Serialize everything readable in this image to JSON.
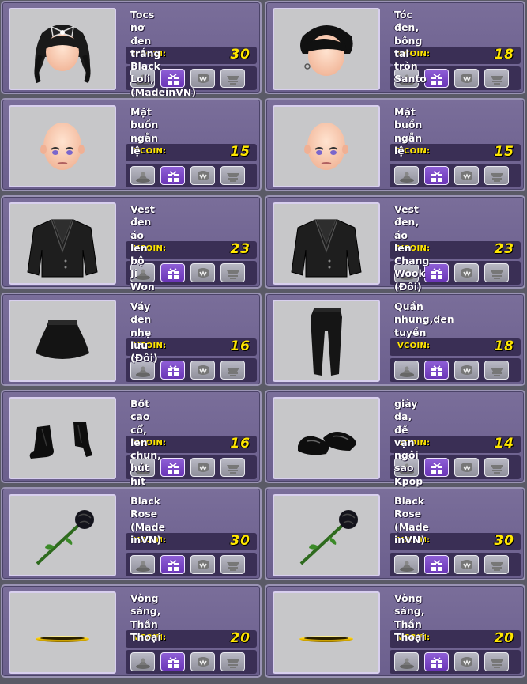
{
  "currency_label": "VCOIN:",
  "items": [
    {
      "name": "Tocs nơ đen trắng Black Loli,(MadeinVN)",
      "price": "30",
      "icon": "hair-bow-icon"
    },
    {
      "name": "Tóc đen, bông tai tròn Santo",
      "price": "18",
      "icon": "hair-earring-icon"
    },
    {
      "name": "Mặt buồn ngẫn lệ",
      "price": "15",
      "icon": "sad-face-icon"
    },
    {
      "name": "Mặt buồn ngẫn lệ",
      "price": "15",
      "icon": "sad-face-icon"
    },
    {
      "name": "Vest đen áo len bộ Ji Won",
      "price": "23",
      "icon": "black-vest-icon"
    },
    {
      "name": "Vest đen, áo len Chang Wook (Đôi)",
      "price": "23",
      "icon": "black-vest-icon"
    },
    {
      "name": "Váy đen nhẹ lưu (Đôi)",
      "price": "16",
      "icon": "black-skirt-icon"
    },
    {
      "name": "Quần nhung,đen tuyền",
      "price": "18",
      "icon": "black-pants-icon"
    },
    {
      "name": "Bốt cao cổ, len chun, hút hít",
      "price": "16",
      "icon": "ankle-boots-icon"
    },
    {
      "name": "giày da, đế vạn ngôi sao Kpop",
      "price": "14",
      "icon": "leather-shoes-icon"
    },
    {
      "name": "Black Rose (Made inVN)",
      "price": "30",
      "icon": "black-rose-icon"
    },
    {
      "name": "Black Rose (Made inVN)",
      "price": "30",
      "icon": "black-rose-icon"
    },
    {
      "name": "Vòng sáng, Thần Thoại",
      "price": "20",
      "icon": "halo-ring-icon"
    },
    {
      "name": "Vòng sáng, Thần Thoại",
      "price": "20",
      "icon": "halo-ring-icon"
    }
  ],
  "buttons": [
    {
      "name": "try-on-button",
      "icon": "mannequin-icon"
    },
    {
      "name": "gift-button",
      "icon": "gift-icon"
    },
    {
      "name": "wishlist-button",
      "icon": "wish-icon"
    },
    {
      "name": "cart-button",
      "icon": "cart-icon"
    }
  ]
}
